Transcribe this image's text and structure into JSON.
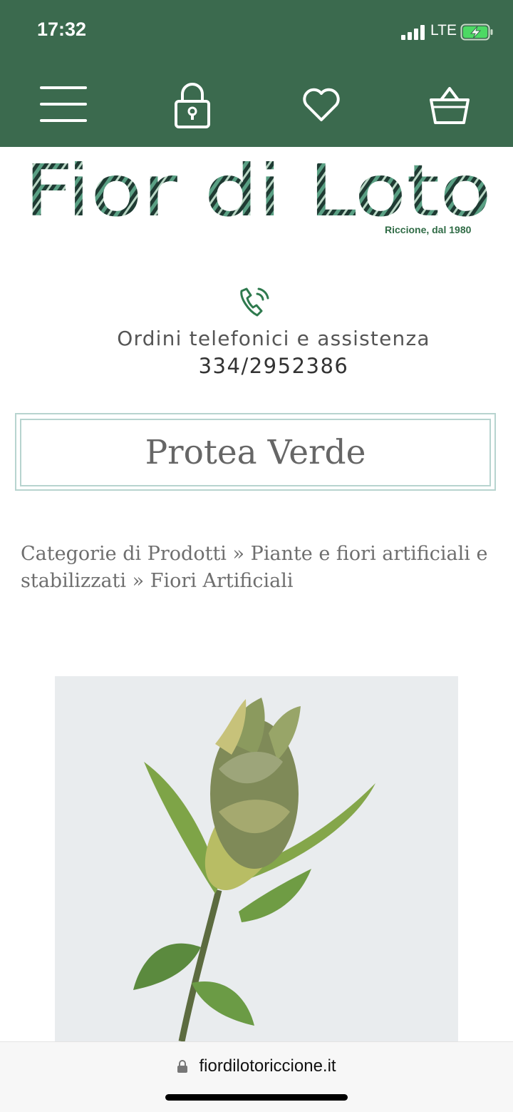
{
  "status_bar": {
    "time": "17:32",
    "network": "LTE",
    "icons": [
      "signal-icon",
      "battery-charging-icon"
    ]
  },
  "header": {
    "background_color": "#3b6a4e",
    "icons": [
      "menu-icon",
      "lock-icon",
      "heart-icon",
      "shopping-basket-icon"
    ]
  },
  "logo": {
    "title": "Fior di Loto",
    "subtitle": "Riccione, dal 1980"
  },
  "contact": {
    "icon": "phone-icon",
    "label": "Ordini telefonici e assistenza",
    "phone": "334/2952386"
  },
  "product": {
    "title": "Protea Verde",
    "image_alt": "protea-flower-image"
  },
  "breadcrumb": {
    "items": [
      "Categorie di Prodotti",
      "Piante e fiori artificiali e stabilizzati",
      "Fiori Artificiali"
    ],
    "separator": "»"
  },
  "browser": {
    "url": "fiordilotoriccione.it"
  },
  "colors": {
    "brand_green": "#3b6a4e",
    "accent_teal": "#b7d4cf"
  }
}
